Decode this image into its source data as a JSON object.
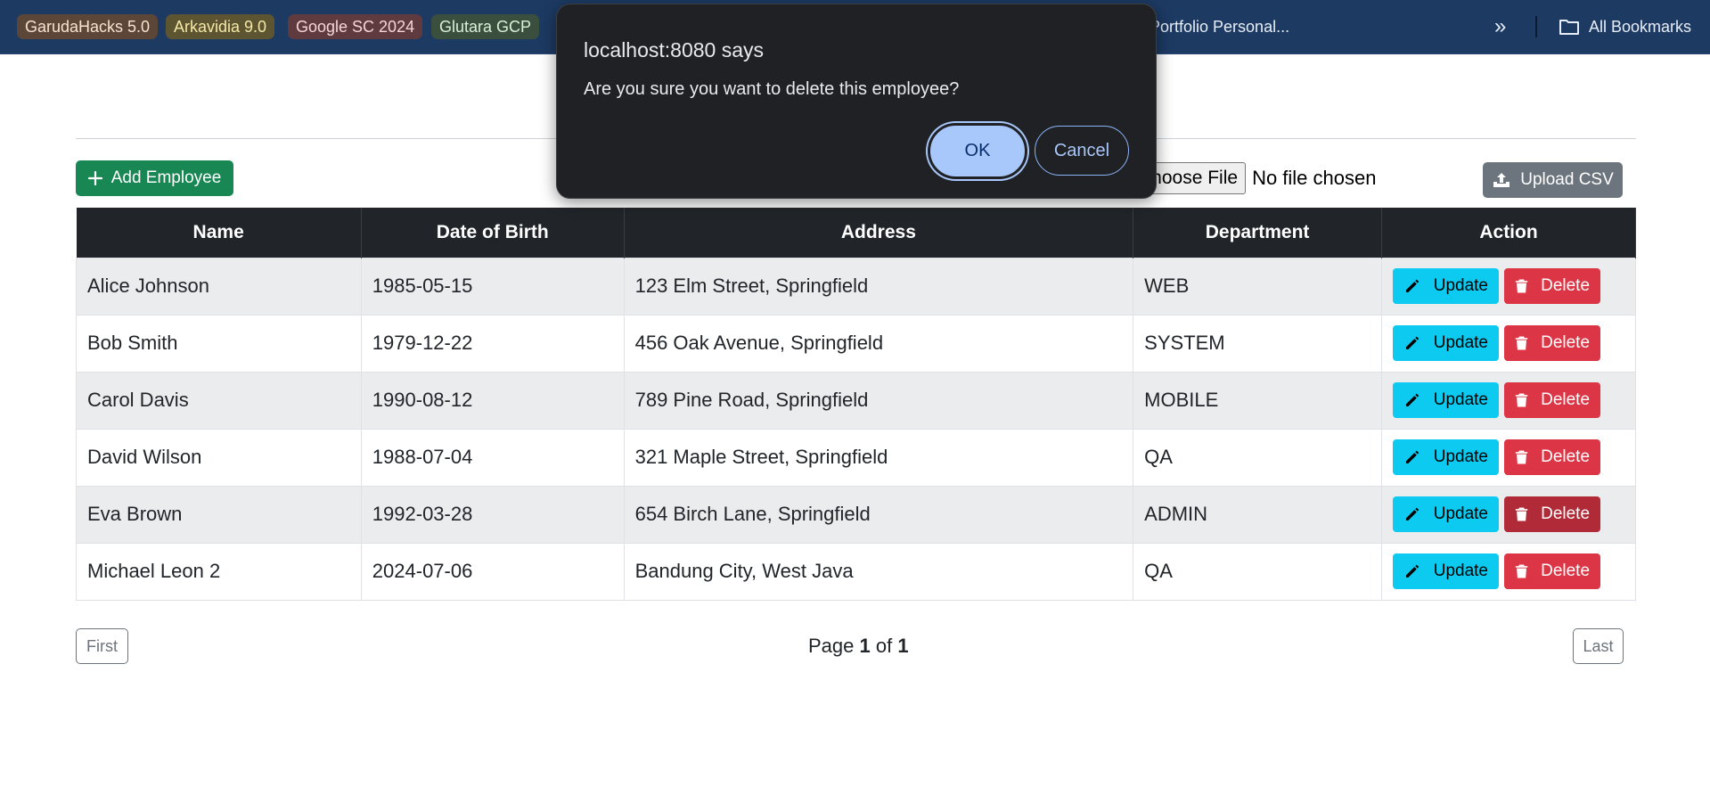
{
  "bookmarks": {
    "chips": [
      {
        "label": "GarudaHacks 5.0",
        "bg": "#5b4637",
        "fg": "#f6e3cf"
      },
      {
        "label": "Arkavidia 9.0",
        "bg": "#5d5531",
        "fg": "#f4e7a6"
      },
      {
        "label": "Google SC 2024",
        "bg": "#5f3b3f",
        "fg": "#f5d6d6"
      },
      {
        "label": "Glutara GCP",
        "bg": "#3b4f3e",
        "fg": "#dcefd6"
      }
    ],
    "partial_item": "Portfolio Personal...",
    "overflow_icon": "double-chevron-right-icon",
    "all_bookmarks": "All Bookmarks"
  },
  "toolbar": {
    "add_label": "Add Employee",
    "file_button": "Choose File",
    "file_status": "No file chosen",
    "upload_label": "Upload CSV"
  },
  "table": {
    "headers": [
      "Name",
      "Date of Birth",
      "Address",
      "Department",
      "Action"
    ],
    "rows": [
      {
        "name": "Alice Johnson",
        "dob": "1985-05-15",
        "address": "123 Elm Street, Springfield",
        "department": "WEB"
      },
      {
        "name": "Bob Smith",
        "dob": "1979-12-22",
        "address": "456 Oak Avenue, Springfield",
        "department": "SYSTEM"
      },
      {
        "name": "Carol Davis",
        "dob": "1990-08-12",
        "address": "789 Pine Road, Springfield",
        "department": "MOBILE"
      },
      {
        "name": "David Wilson",
        "dob": "1988-07-04",
        "address": "321 Maple Street, Springfield",
        "department": "QA"
      },
      {
        "name": "Eva Brown",
        "dob": "1992-03-28",
        "address": "654 Birch Lane, Springfield",
        "department": "ADMIN"
      },
      {
        "name": "Michael Leon 2",
        "dob": "2024-07-06",
        "address": "Bandung City, West Java",
        "department": "QA"
      }
    ],
    "update_label": "Update",
    "delete_label": "Delete"
  },
  "pagination": {
    "first": "First",
    "last": "Last",
    "page_word": "Page",
    "current": "1",
    "of_word": "of",
    "total": "1"
  },
  "dialog": {
    "title": "localhost:8080 says",
    "message": "Are you sure you want to delete this employee?",
    "ok": "OK",
    "cancel": "Cancel"
  },
  "colors": {
    "add": "#198754",
    "update": "#0dcaf0",
    "delete": "#dc3545",
    "header": "#212529",
    "upload": "#6c757d"
  }
}
